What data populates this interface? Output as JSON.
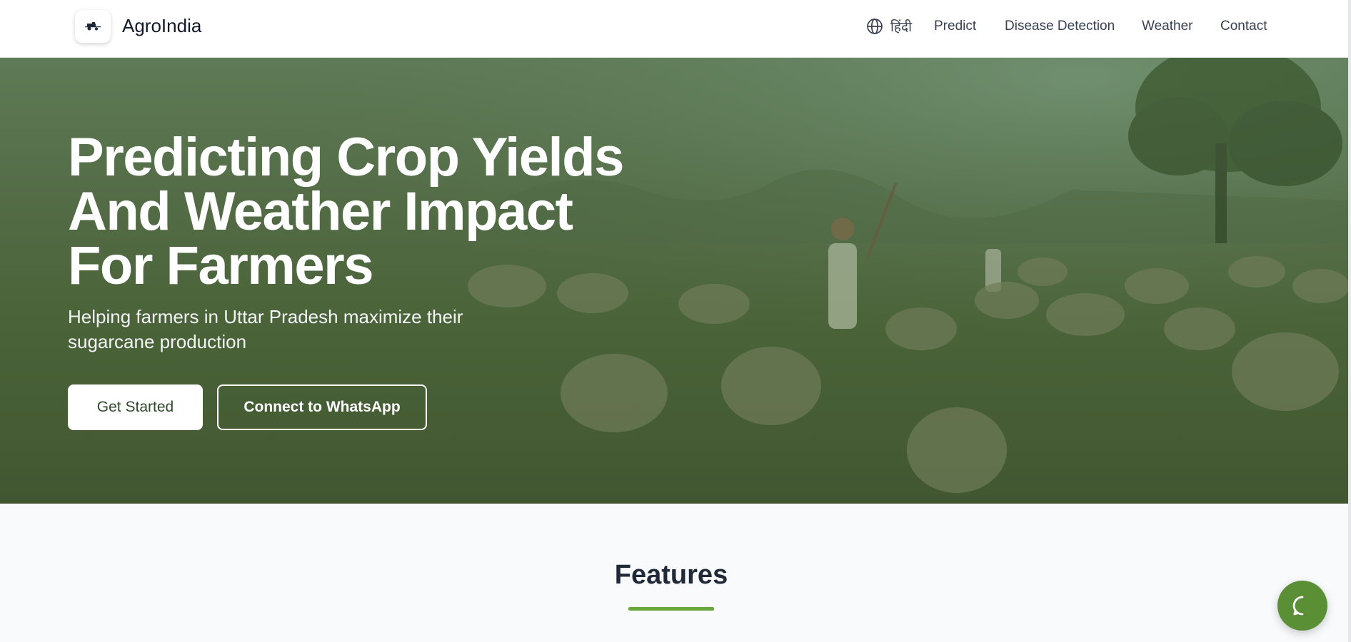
{
  "brand": {
    "name": "AgroIndia",
    "logo_icon": "tractor-icon"
  },
  "nav": {
    "language_icon": "globe-icon",
    "language_label": "हिंदी",
    "links": [
      "Predict",
      "Disease Detection",
      "Weather",
      "Contact"
    ]
  },
  "hero": {
    "title_lines": [
      "Predicting Crop Yields",
      "And Weather Impact",
      "For Farmers"
    ],
    "subtitle_lines": [
      "Helping farmers in Uttar Pradesh maximize their",
      "sugarcane production"
    ],
    "primary_button": "Get Started",
    "secondary_button": "Connect to WhatsApp",
    "background_scene": "farmer-herding-sheep-field"
  },
  "features": {
    "title": "Features"
  },
  "chat": {
    "icon": "chat-bubble-icon"
  },
  "colors": {
    "accent": "#6aa83a",
    "chat_button": "#5a8f36",
    "hero_overlay": "#4f6b42",
    "header_bg": "#ffffff",
    "page_bg": "#f8fafc"
  }
}
